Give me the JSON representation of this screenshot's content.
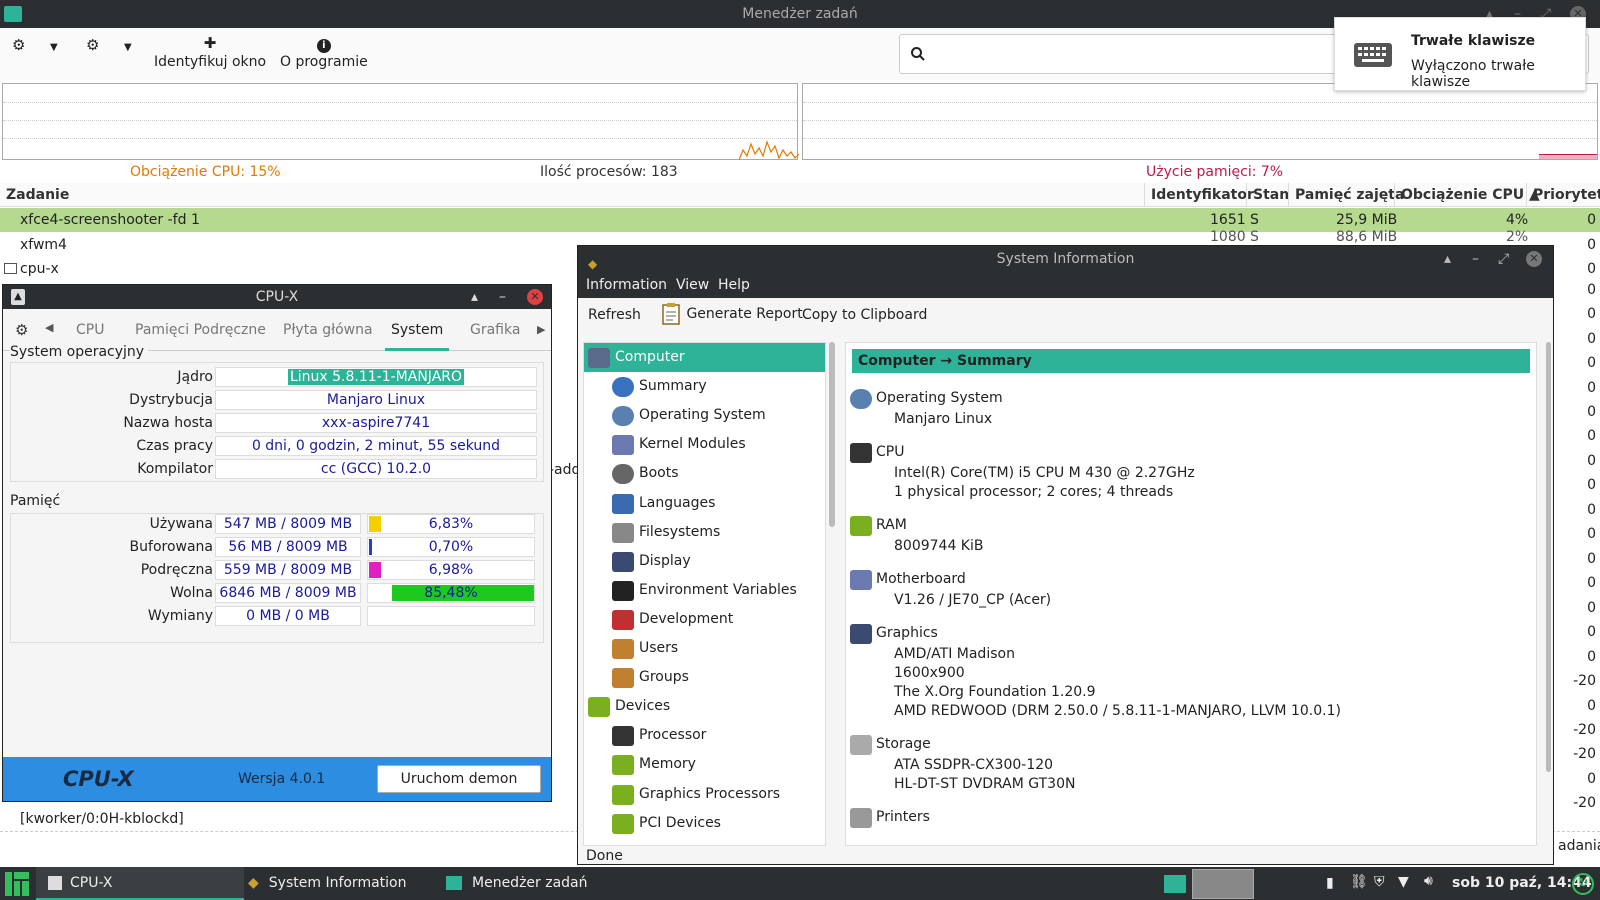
{
  "task_manager": {
    "title": "Menedżer zadań",
    "toolbar": {
      "identify_window": "Identyfikuj okno",
      "about": "O programie"
    },
    "stats": {
      "cpu_load": "Obciążenie CPU: 15%",
      "process_count": "Ilość procesów: 183",
      "memory_usage": "Użycie pamięci: 7%"
    },
    "columns": {
      "task": "Zadanie",
      "id": "Identyfikator",
      "state": "Stan",
      "memory": "Pamięć zajęta",
      "cpu": "Obciążenie CPU ▲",
      "priority": "Priorytet"
    },
    "rows": [
      {
        "name": "xfce4-screenshooter -fd 1",
        "id": "1651",
        "state": "S",
        "memory": "25,9 MiB",
        "cpu": "4%",
        "priority": "0"
      },
      {
        "name": "xfwm4",
        "id": "1080",
        "state": "S",
        "memory": "88,6 MiB",
        "cpu": "2%",
        "priority": "0"
      },
      {
        "name": "cpu-x",
        "priority": "0"
      }
    ],
    "extra_priorities": [
      "0",
      "0",
      "0",
      "0",
      "0",
      "0",
      "0",
      "0",
      "0",
      "0",
      "0",
      "0",
      "0",
      "0",
      "0",
      "0",
      "-20",
      "0",
      "-20",
      "-20",
      "0",
      "-20"
    ],
    "partial_text_add": "-add",
    "partial_text_kworker": "[kworker/0:0H-kblockd]",
    "partial_text_right": "adania",
    "colors": {
      "cpu_label": "#e07b00",
      "mem_label": "#c0184a",
      "selected_row": "#b5d98e"
    }
  },
  "notification": {
    "title": "Trwałe klawisze",
    "body": "Wyłączono trwałe klawisze"
  },
  "cpux": {
    "title": "CPU-X",
    "tabs": [
      "CPU",
      "Pamięci Podręczne",
      "Płyta główna",
      "System",
      "Grafika"
    ],
    "active_tab": "System",
    "os_group": "System operacyjny",
    "os_rows": [
      {
        "label": "Jądro",
        "value": "Linux 5.8.11-1-MANJARO"
      },
      {
        "label": "Dystrybucja",
        "value": "Manjaro Linux"
      },
      {
        "label": "Nazwa hosta",
        "value": "xxx-aspire7741"
      },
      {
        "label": "Czas pracy",
        "value": "0 dni, 0 godzin, 2 minut, 55 sekund"
      },
      {
        "label": "Kompilator",
        "value": "cc (GCC) 10.2.0"
      }
    ],
    "mem_group": "Pamięć",
    "mem_rows": [
      {
        "label": "Używana",
        "value": "547 MB /  8009 MB",
        "percent": "6,83%",
        "fraction": 0.0683,
        "color": "#f5d000"
      },
      {
        "label": "Buforowana",
        "value": "56 MB /  8009 MB",
        "percent": "0,70%",
        "fraction": 0.007,
        "color": "#2040d0"
      },
      {
        "label": "Podręczna",
        "value": "559 MB /  8009 MB",
        "percent": "6,98%",
        "fraction": 0.0698,
        "color": "#e020c0"
      },
      {
        "label": "Wolna",
        "value": "6846 MB /  8009 MB",
        "percent": "85,48%",
        "fraction": 0.8548,
        "color": "#1ec81e"
      },
      {
        "label": "Wymiany",
        "value": "0 MB /     0 MB",
        "percent": "",
        "fraction": 0,
        "color": "#1ec81e"
      }
    ],
    "footer": {
      "logo": "CPU-X",
      "version": "Wersja 4.0.1",
      "daemon_button": "Uruchom demon"
    }
  },
  "sysinfo": {
    "title": "System Information",
    "menu": [
      "Information",
      "View",
      "Help"
    ],
    "toolbar": {
      "refresh": "Refresh",
      "report": "Generate Report",
      "clipboard": "Copy to Clipboard"
    },
    "tree": [
      {
        "label": "Computer",
        "level": 0,
        "icon": "computer-icon",
        "selected": true
      },
      {
        "label": "Summary",
        "level": 1,
        "icon": "info-icon"
      },
      {
        "label": "Operating System",
        "level": 1,
        "icon": "gear-icon"
      },
      {
        "label": "Kernel Modules",
        "level": 1,
        "icon": "module-icon"
      },
      {
        "label": "Boots",
        "level": 1,
        "icon": "power-icon"
      },
      {
        "label": "Languages",
        "level": 1,
        "icon": "language-icon"
      },
      {
        "label": "Filesystems",
        "level": 1,
        "icon": "drive-icon"
      },
      {
        "label": "Display",
        "level": 1,
        "icon": "monitor-icon"
      },
      {
        "label": "Environment Variables",
        "level": 1,
        "icon": "terminal-icon"
      },
      {
        "label": "Development",
        "level": 1,
        "icon": "development-icon"
      },
      {
        "label": "Users",
        "level": 1,
        "icon": "users-icon"
      },
      {
        "label": "Groups",
        "level": 1,
        "icon": "groups-icon"
      },
      {
        "label": "Devices",
        "level": 0,
        "icon": "devices-icon"
      },
      {
        "label": "Processor",
        "level": 1,
        "icon": "processor-icon"
      },
      {
        "label": "Memory",
        "level": 1,
        "icon": "memory-icon"
      },
      {
        "label": "Graphics Processors",
        "level": 1,
        "icon": "gpu-icon"
      },
      {
        "label": "PCI Devices",
        "level": 1,
        "icon": "pci-icon"
      }
    ],
    "detail_header": "Computer → Summary",
    "sections": [
      {
        "title": "Operating System",
        "icon": "gear-icon",
        "lines": [
          "Manjaro Linux"
        ]
      },
      {
        "title": "CPU",
        "icon": "processor-icon",
        "lines": [
          "Intel(R) Core(TM) i5 CPU       M 430  @ 2.27GHz",
          "1 physical processor; 2 cores; 4 threads"
        ]
      },
      {
        "title": "RAM",
        "icon": "memory-icon",
        "lines": [
          "8009744 KiB"
        ]
      },
      {
        "title": "Motherboard",
        "icon": "module-icon",
        "lines": [
          "V1.26 / JE70_CP (Acer)"
        ]
      },
      {
        "title": "Graphics",
        "icon": "monitor-icon",
        "lines": [
          "AMD/ATI Madison",
          "1600x900",
          "The X.Org Foundation 1.20.9",
          "AMD REDWOOD (DRM 2.50.0 / 5.8.11-1-MANJARO, LLVM 10.0.1)"
        ]
      },
      {
        "title": "Storage",
        "icon": "drive-icon",
        "lines": [
          "ATA SSDPR-CX300-120",
          "HL-DT-ST DVDRAM GT30N"
        ]
      },
      {
        "title": "Printers",
        "icon": "printer-icon",
        "lines": []
      }
    ],
    "status": "Done",
    "accent": "#2eb398"
  },
  "taskbar": {
    "items": [
      "CPU-X",
      "System Information",
      "Menedżer zadań"
    ],
    "clock": "sob 10 paź, 14:44"
  }
}
